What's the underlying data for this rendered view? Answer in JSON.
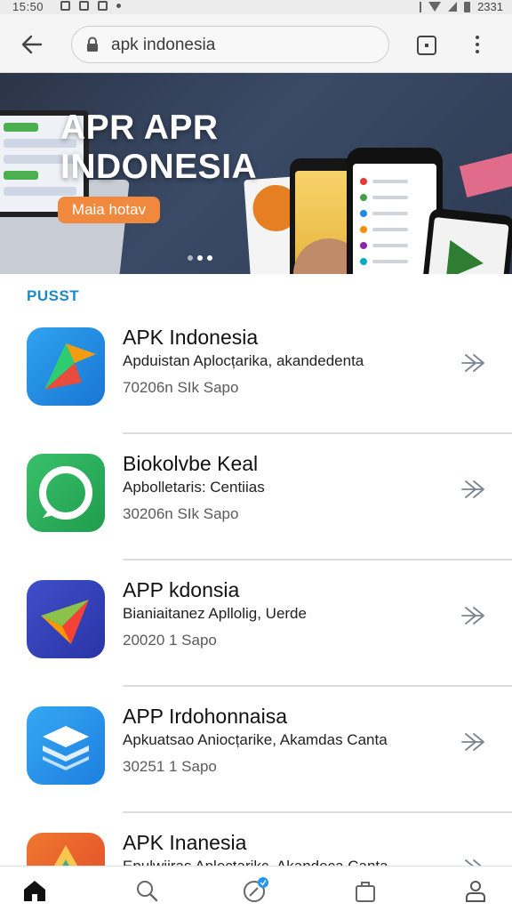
{
  "status_bar": {
    "time": "15:50",
    "clock_right": "2331"
  },
  "browser": {
    "url": "apk indonesia"
  },
  "banner": {
    "title_line1": "APR APR",
    "title_line2": "INDONESIA",
    "cta": "Maia hotav",
    "slides": 3,
    "active_slide": 1
  },
  "section": {
    "label": "PUSST"
  },
  "apps": [
    {
      "name": "APK Indonesia",
      "description": "Apduistan Aplocțarika, akandedenta",
      "meta": "70206n SIk Sapo",
      "icon": "green-orange-arrow-icon",
      "color": "#2fa3f0"
    },
    {
      "name": "Biokolvbe Keal",
      "description": "Apbolletaris: Centiias",
      "meta": "30206n SIk Sapo",
      "icon": "chat-bubble-icon",
      "color": "#39c06a"
    },
    {
      "name": "APP kdonsia",
      "description": "Bianiaitanez Apllolig, Uerde",
      "meta": "20020 1 Sapo",
      "icon": "paper-plane-icon",
      "color": "#3e4fc8"
    },
    {
      "name": "APP Irdohonnaisa",
      "description": "Apkuatsao Aniocțarike, Akamdas Canta",
      "meta": "30251 1 Sapo",
      "icon": "layers-icon",
      "color": "#35a8f2"
    },
    {
      "name": "APK Inanesia",
      "description": "Epulwiiras Aplecțarikc, Akandeca Canta",
      "meta": "",
      "icon": "triangle-icon",
      "color": "#f0772f"
    }
  ],
  "bottom_nav": [
    "home",
    "search",
    "discover",
    "shopping",
    "profile"
  ]
}
